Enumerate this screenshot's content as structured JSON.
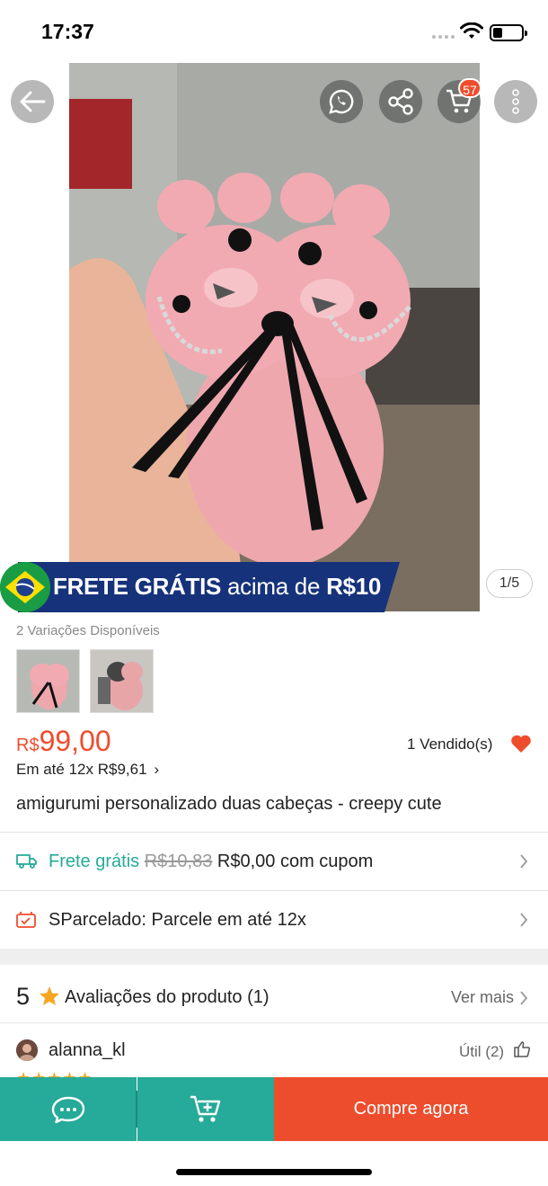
{
  "status_bar": {
    "time": "17:37"
  },
  "header": {
    "cart_count": "57"
  },
  "banner": {
    "frete_text": "FRETE GRÁTIS",
    "frete_suffix": "acima de",
    "frete_value": "R$10"
  },
  "gallery": {
    "page_indicator": "1/5"
  },
  "variations": {
    "label": "2 Variações Disponíveis"
  },
  "price": {
    "currency": "R$",
    "amount": "99,00",
    "sold": "1 Vendido(s)",
    "installments_prefix": "Em até",
    "installments_value": "12x R$9,61"
  },
  "product": {
    "title": "amigurumi personalizado duas cabeças - creepy cute"
  },
  "shipping": {
    "label": "Frete grátis",
    "old_price": "R$10,83",
    "new_price": "R$0,00 com cupom"
  },
  "sparcelado": {
    "label": "SParcelado: Parcele em até 12x"
  },
  "reviews": {
    "rating": "5",
    "title": "Avaliações do produto",
    "count": "(1)",
    "see_more": "Ver mais"
  },
  "review": {
    "user": "alanna_kl",
    "useful": "Útil (2)",
    "stars": "★★★★★"
  },
  "bottom_bar": {
    "buy_label": "Compre agora"
  },
  "colors": {
    "brand": "#ee4d2d",
    "teal": "#26aa99",
    "banner_blue": "#16327a"
  },
  "icons": [
    "back-arrow-icon",
    "whatsapp-icon",
    "share-icon",
    "cart-icon",
    "more-icon",
    "heart-icon",
    "truck-icon",
    "card-icon",
    "star-icon",
    "thumbs-up-icon",
    "chat-icon",
    "add-to-cart-icon"
  ]
}
